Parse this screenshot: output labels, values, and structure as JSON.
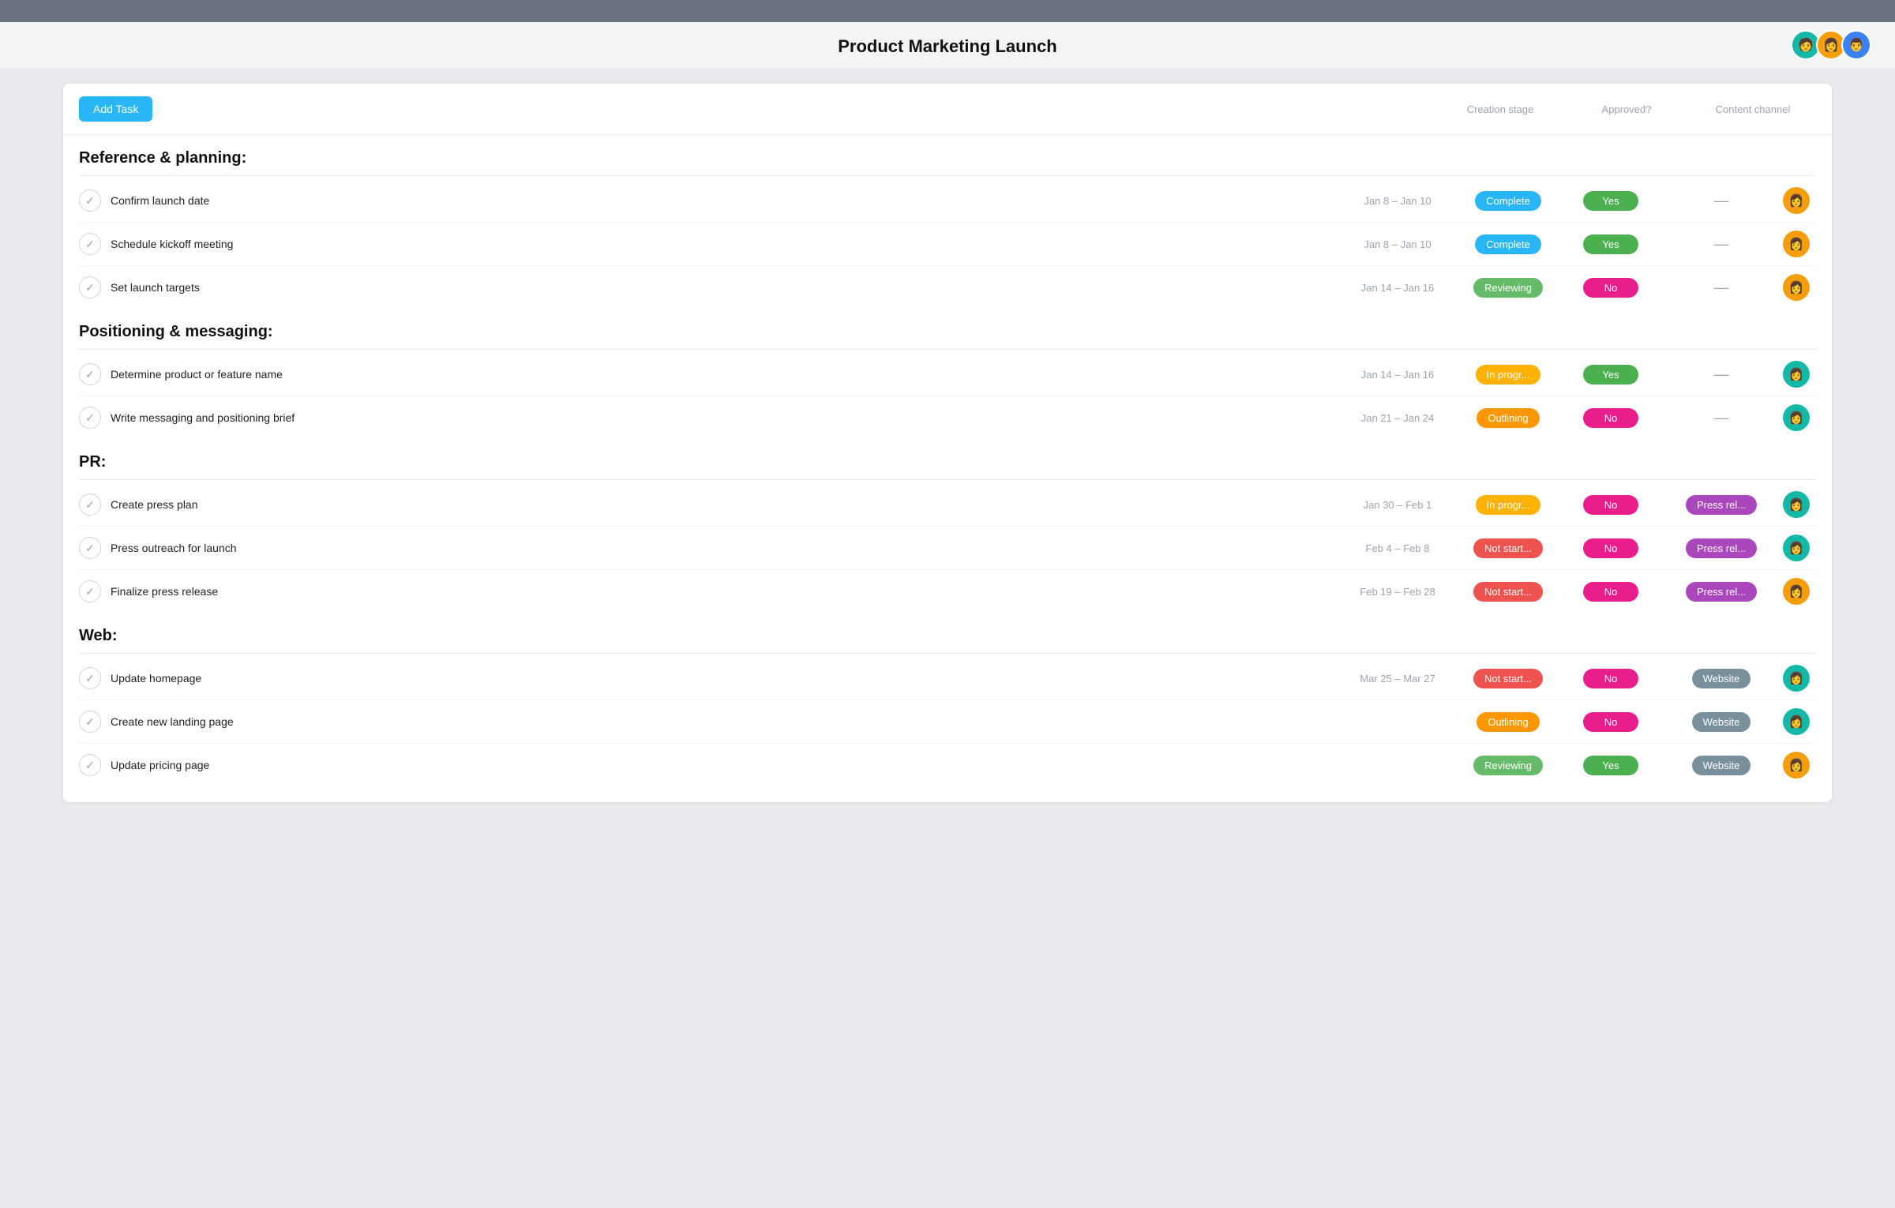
{
  "topbar": {},
  "header": {
    "title": "Product Marketing Launch",
    "avatars": [
      {
        "id": "av1",
        "emoji": "👩",
        "color": "#14b8a6"
      },
      {
        "id": "av2",
        "emoji": "👩",
        "color": "#f59e0b"
      },
      {
        "id": "av3",
        "emoji": "👨",
        "color": "#3b82f6"
      }
    ]
  },
  "toolbar": {
    "add_task_label": "Add Task",
    "col_creation": "Creation stage",
    "col_approved": "Approved?",
    "col_channel": "Content channel"
  },
  "sections": [
    {
      "id": "reference-planning",
      "title": "Reference & planning:",
      "tasks": [
        {
          "id": "t1",
          "name": "Confirm launch date",
          "dates": "Jan 8 – Jan 10",
          "stage": "Complete",
          "stage_class": "badge-complete",
          "approved": "Yes",
          "approved_class": "badge-yes",
          "channel": "—",
          "channel_class": "",
          "avatar_emoji": "👩",
          "avatar_color": "#f59e0b"
        },
        {
          "id": "t2",
          "name": "Schedule kickoff meeting",
          "dates": "Jan 8 – Jan 10",
          "stage": "Complete",
          "stage_class": "badge-complete",
          "approved": "Yes",
          "approved_class": "badge-yes",
          "channel": "—",
          "channel_class": "",
          "avatar_emoji": "👩",
          "avatar_color": "#f59e0b"
        },
        {
          "id": "t3",
          "name": "Set launch targets",
          "dates": "Jan 14 – Jan 16",
          "stage": "Reviewing",
          "stage_class": "badge-reviewing",
          "approved": "No",
          "approved_class": "badge-no",
          "channel": "—",
          "channel_class": "",
          "avatar_emoji": "👩",
          "avatar_color": "#f59e0b"
        }
      ]
    },
    {
      "id": "positioning-messaging",
      "title": "Positioning & messaging:",
      "tasks": [
        {
          "id": "t4",
          "name": "Determine product or feature name",
          "dates": "Jan 14 – Jan 16",
          "stage": "In progr...",
          "stage_class": "badge-inprogress",
          "approved": "Yes",
          "approved_class": "badge-yes",
          "channel": "—",
          "channel_class": "",
          "avatar_emoji": "👩",
          "avatar_color": "#14b8a6"
        },
        {
          "id": "t5",
          "name": "Write messaging and positioning brief",
          "dates": "Jan 21 – Jan 24",
          "stage": "Outlining",
          "stage_class": "badge-outlining",
          "approved": "No",
          "approved_class": "badge-no",
          "channel": "—",
          "channel_class": "",
          "avatar_emoji": "👩",
          "avatar_color": "#14b8a6"
        }
      ]
    },
    {
      "id": "pr",
      "title": "PR:",
      "tasks": [
        {
          "id": "t6",
          "name": "Create press plan",
          "dates": "Jan 30 – Feb 1",
          "stage": "In progr...",
          "stage_class": "badge-inprogress",
          "approved": "No",
          "approved_class": "badge-no",
          "channel": "Press rel...",
          "channel_class": "badge-press",
          "avatar_emoji": "👩",
          "avatar_color": "#14b8a6"
        },
        {
          "id": "t7",
          "name": "Press outreach for launch",
          "dates": "Feb 4 – Feb 8",
          "stage": "Not start...",
          "stage_class": "badge-notstarted",
          "approved": "No",
          "approved_class": "badge-no",
          "channel": "Press rel...",
          "channel_class": "badge-press",
          "avatar_emoji": "👩",
          "avatar_color": "#14b8a6"
        },
        {
          "id": "t8",
          "name": "Finalize press release",
          "dates": "Feb 19 – Feb 28",
          "stage": "Not start...",
          "stage_class": "badge-notstarted",
          "approved": "No",
          "approved_class": "badge-no",
          "channel": "Press rel...",
          "channel_class": "badge-press",
          "avatar_emoji": "👩",
          "avatar_color": "#f59e0b"
        }
      ]
    },
    {
      "id": "web",
      "title": "Web:",
      "tasks": [
        {
          "id": "t9",
          "name": "Update homepage",
          "dates": "Mar 25 – Mar 27",
          "stage": "Not start...",
          "stage_class": "badge-notstarted",
          "approved": "No",
          "approved_class": "badge-no",
          "channel": "Website",
          "channel_class": "badge-website",
          "avatar_emoji": "👩",
          "avatar_color": "#14b8a6"
        },
        {
          "id": "t10",
          "name": "Create new landing page",
          "dates": "",
          "stage": "Outlining",
          "stage_class": "badge-outlining",
          "approved": "No",
          "approved_class": "badge-no",
          "channel": "Website",
          "channel_class": "badge-website",
          "avatar_emoji": "👩",
          "avatar_color": "#14b8a6"
        },
        {
          "id": "t11",
          "name": "Update pricing page",
          "dates": "",
          "stage": "Reviewing",
          "stage_class": "badge-reviewing",
          "approved": "Yes",
          "approved_class": "badge-yes",
          "channel": "Website",
          "channel_class": "badge-website",
          "avatar_emoji": "👩",
          "avatar_color": "#f59e0b"
        }
      ]
    }
  ]
}
